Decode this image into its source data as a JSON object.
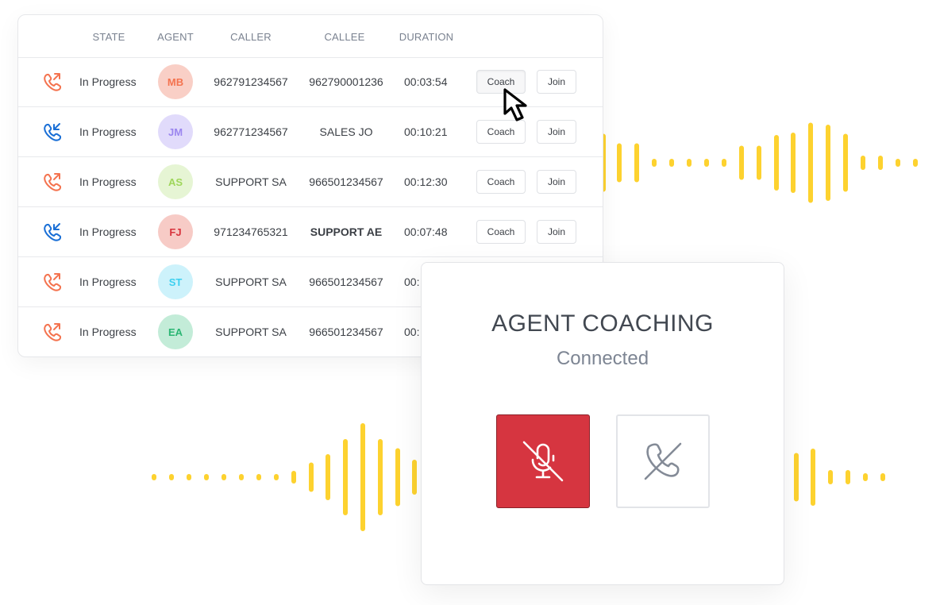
{
  "table": {
    "headers": [
      "STATE",
      "AGENT",
      "CALLER",
      "CALLEE",
      "DURATION"
    ],
    "rows": [
      {
        "direction": "outgoing-call-icon",
        "state": "In Progress",
        "agent": "MB",
        "caller": "962791234567",
        "callee": "962790001236",
        "duration": "00:03:54",
        "coach": "Coach",
        "join": "Join",
        "avatar_bg": "#f9cfc6",
        "avatar_fg": "#f4734f"
      },
      {
        "direction": "incoming-call-icon",
        "state": "In Progress",
        "agent": "JM",
        "caller": "962771234567",
        "callee": "SALES JO",
        "duration": "00:10:21",
        "coach": "Coach",
        "join": "Join",
        "avatar_bg": "#e1dbfb",
        "avatar_fg": "#9b86ef"
      },
      {
        "direction": "outgoing-call-icon",
        "state": "In Progress",
        "agent": "AS",
        "caller": "SUPPORT SA",
        "callee": "966501234567",
        "duration": "00:12:30",
        "coach": "Coach",
        "join": "Join",
        "avatar_bg": "#e6f5d4",
        "avatar_fg": "#9fd65a"
      },
      {
        "direction": "incoming-call-icon",
        "state": "In Progress",
        "agent": "FJ",
        "caller": "971234765321",
        "callee": "SUPPORT AE",
        "duration": "00:07:48",
        "coach": "Coach",
        "join": "Join",
        "avatar_bg": "#f7cbc6",
        "avatar_fg": "#d8333c"
      },
      {
        "direction": "outgoing-call-icon",
        "state": "In Progress",
        "agent": "ST",
        "caller": "SUPPORT SA",
        "callee": "966501234567",
        "duration": "00:",
        "coach": "",
        "join": "",
        "avatar_bg": "#cdf2fb",
        "avatar_fg": "#3dd0f0"
      },
      {
        "direction": "outgoing-call-icon",
        "state": "In Progress",
        "agent": "EA",
        "caller": "SUPPORT SA",
        "callee": "966501234567",
        "duration": "00:",
        "coach": "",
        "join": "",
        "avatar_bg": "#c3ecd8",
        "avatar_fg": "#2bb673"
      }
    ]
  },
  "modal": {
    "title": "AGENT COACHING",
    "status": "Connected",
    "mute_button": "mic-off-icon",
    "hangup_button": "phone-off-icon"
  },
  "colors": {
    "outgoing": "#f4734f",
    "incoming": "#1a6fd6",
    "wave": "#fdd22f",
    "mute_bg": "#d63540"
  }
}
